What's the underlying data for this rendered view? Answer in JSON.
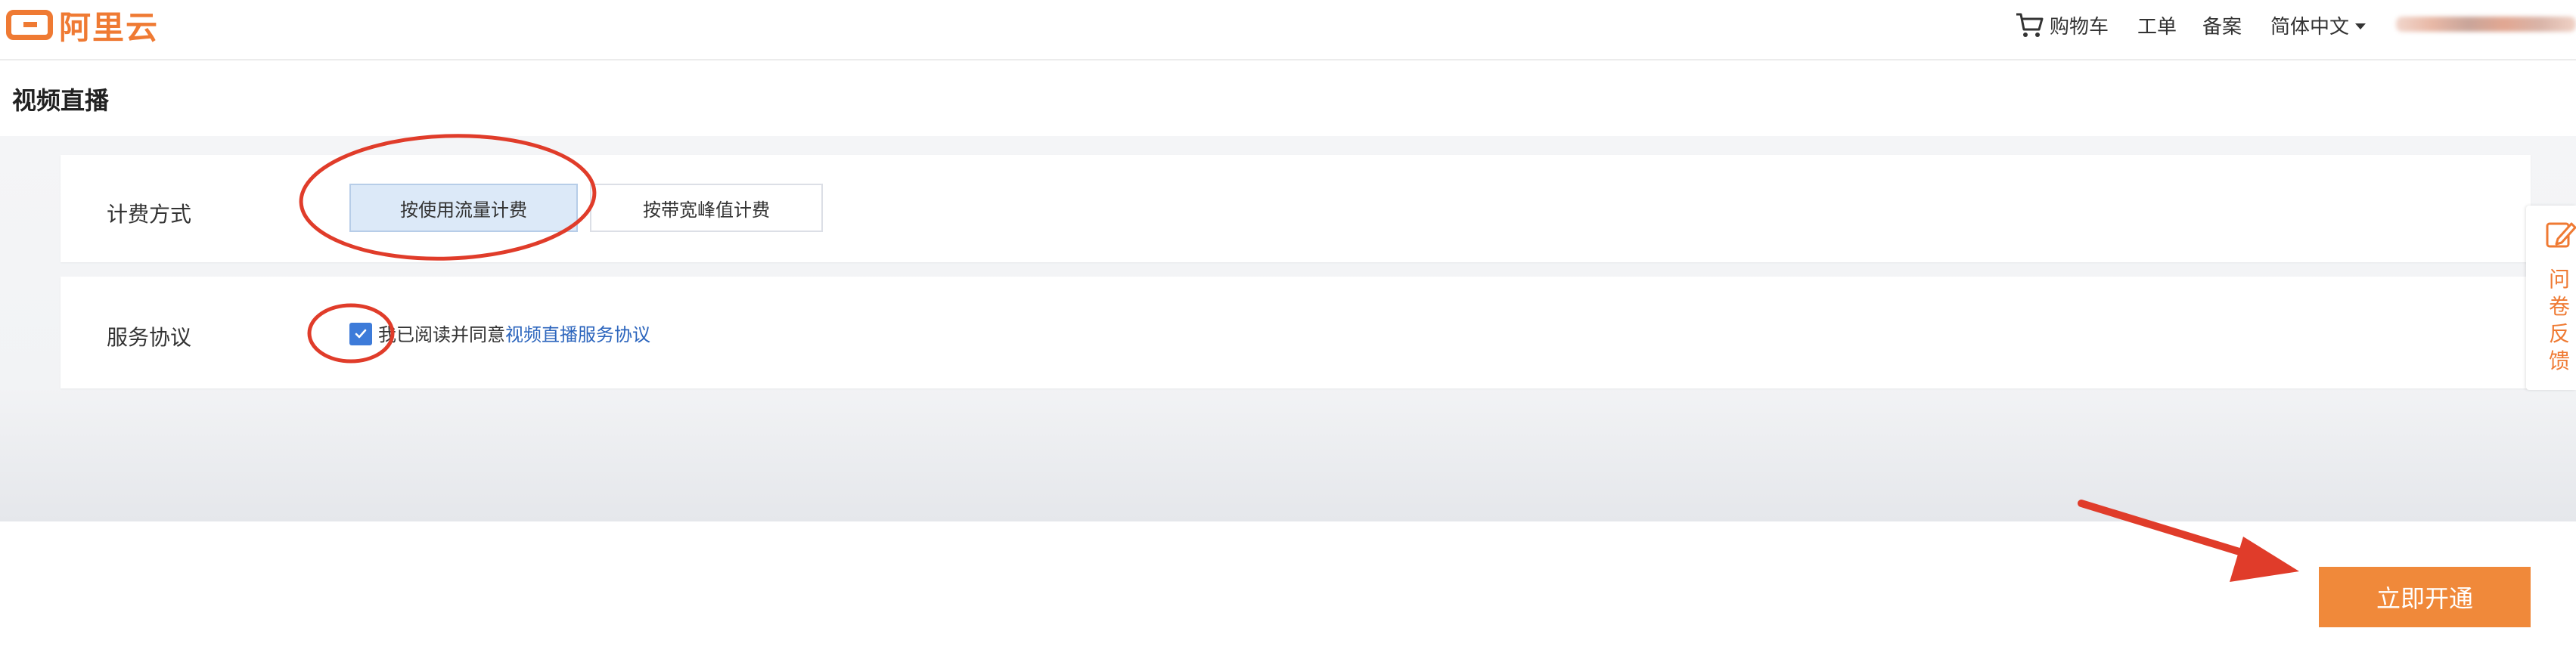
{
  "header": {
    "logo_text": "阿里云",
    "nav": {
      "cart": "购物车",
      "ticket": "工单",
      "beian": "备案",
      "language": "简体中文"
    }
  },
  "page": {
    "title": "视频直播"
  },
  "billing": {
    "label": "计费方式",
    "options": [
      {
        "label": "按使用流量计费",
        "selected": true
      },
      {
        "label": "按带宽峰值计费",
        "selected": false
      }
    ]
  },
  "terms": {
    "label": "服务协议",
    "checked": true,
    "agree_text": "我已阅读并同意",
    "link_text": "视频直播服务协议"
  },
  "feedback": {
    "text": "问卷反馈"
  },
  "submit": {
    "label": "立即开通"
  },
  "colors": {
    "brand": "#ef7a33",
    "primary_button": "#f0893a",
    "link": "#2c65bd",
    "checkbox": "#3d7bd9",
    "annotation": "#e03c2a"
  },
  "icons": {
    "cart": "shopping-cart-icon",
    "caret": "chevron-down-icon",
    "check": "checkmark-icon",
    "feedback": "edit-pencil-icon"
  }
}
